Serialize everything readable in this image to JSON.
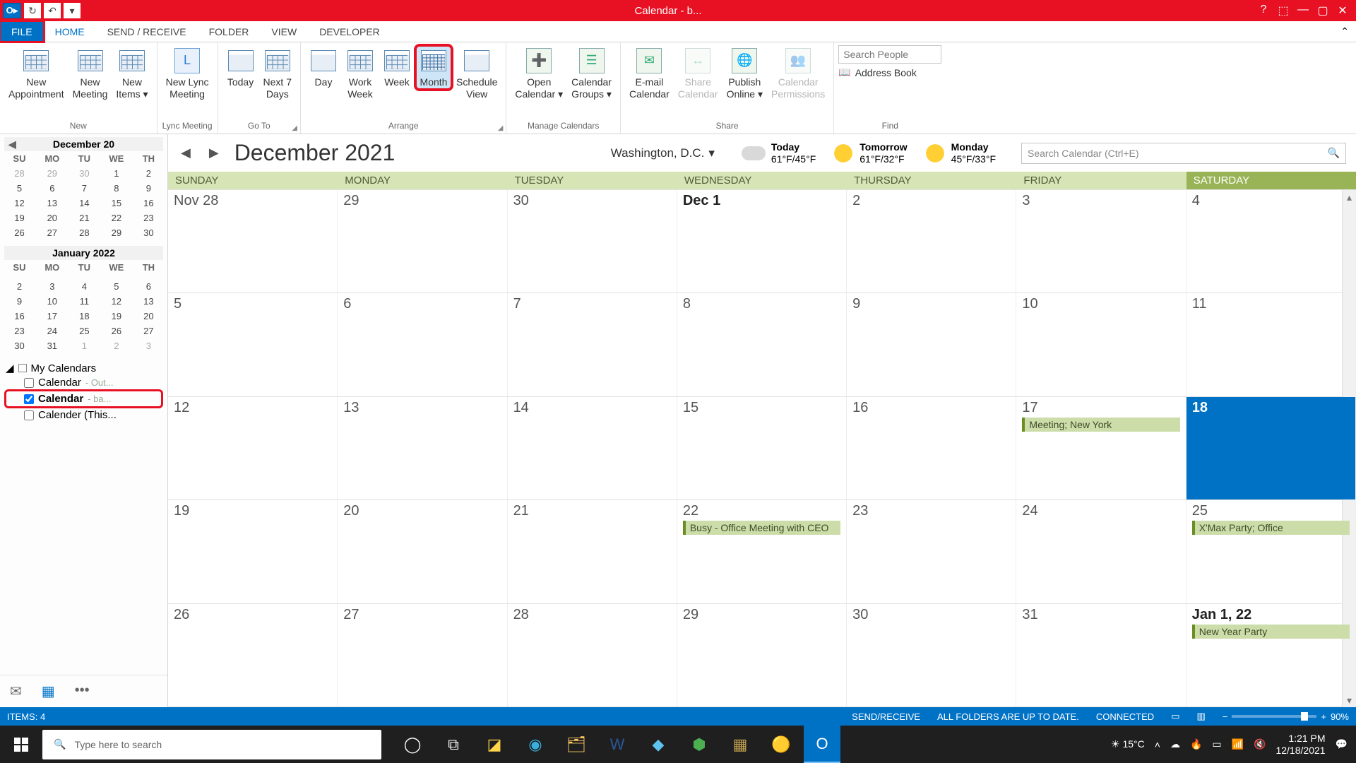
{
  "title": "Calendar - b...",
  "qat": {
    "send_receive_icon": "↻",
    "undo_icon": "↶",
    "dropdown_icon": "▾"
  },
  "tabs": {
    "file": "FILE",
    "home": "HOME",
    "send_receive": "SEND / RECEIVE",
    "folder": "FOLDER",
    "view": "VIEW",
    "developer": "DEVELOPER"
  },
  "ribbon": {
    "new_group": "New",
    "new_appointment": "New\nAppointment",
    "new_meeting": "New\nMeeting",
    "new_items": "New\nItems ▾",
    "lync_group": "Lync Meeting",
    "new_lync": "New Lync\nMeeting",
    "goto_group": "Go To",
    "today": "Today",
    "next7": "Next 7\nDays",
    "arrange_group": "Arrange",
    "day": "Day",
    "work_week": "Work\nWeek",
    "week": "Week",
    "month": "Month",
    "schedule": "Schedule\nView",
    "manage_group": "Manage Calendars",
    "open_cal": "Open\nCalendar ▾",
    "cal_groups": "Calendar\nGroups ▾",
    "share_group": "Share",
    "email_cal": "E-mail\nCalendar",
    "share_cal": "Share\nCalendar",
    "publish": "Publish\nOnline ▾",
    "cal_perms": "Calendar\nPermissions",
    "find_group": "Find",
    "search_people": "Search People",
    "address_book": "Address Book"
  },
  "cal_header": {
    "title": "December 2021",
    "location": "Washington,  D.C.",
    "weather": [
      {
        "day": "Today",
        "temp": "61°F/45°F",
        "icon": "cloud"
      },
      {
        "day": "Tomorrow",
        "temp": "61°F/32°F",
        "icon": "sun"
      },
      {
        "day": "Monday",
        "temp": "45°F/33°F",
        "icon": "sun"
      }
    ],
    "search_placeholder": "Search Calendar (Ctrl+E)"
  },
  "dow": [
    "SUNDAY",
    "MONDAY",
    "TUESDAY",
    "WEDNESDAY",
    "THURSDAY",
    "FRIDAY",
    "SATURDAY"
  ],
  "weeks": [
    [
      {
        "n": "Nov 28"
      },
      {
        "n": "29"
      },
      {
        "n": "30"
      },
      {
        "n": "Dec 1",
        "bold": true
      },
      {
        "n": "2"
      },
      {
        "n": "3"
      },
      {
        "n": "4"
      }
    ],
    [
      {
        "n": "5"
      },
      {
        "n": "6"
      },
      {
        "n": "7"
      },
      {
        "n": "8"
      },
      {
        "n": "9"
      },
      {
        "n": "10"
      },
      {
        "n": "11"
      }
    ],
    [
      {
        "n": "12"
      },
      {
        "n": "13"
      },
      {
        "n": "14"
      },
      {
        "n": "15"
      },
      {
        "n": "16"
      },
      {
        "n": "17",
        "events": [
          "Meeting; New York"
        ]
      },
      {
        "n": "18",
        "today": true
      }
    ],
    [
      {
        "n": "19"
      },
      {
        "n": "20"
      },
      {
        "n": "21"
      },
      {
        "n": "22",
        "events": [
          "Busy - Office Meeting with CEO"
        ]
      },
      {
        "n": "23"
      },
      {
        "n": "24"
      },
      {
        "n": "25",
        "events": [
          "X'Max Party; Office"
        ]
      }
    ],
    [
      {
        "n": "26"
      },
      {
        "n": "27"
      },
      {
        "n": "28"
      },
      {
        "n": "29"
      },
      {
        "n": "30"
      },
      {
        "n": "31"
      },
      {
        "n": "Jan 1, 22",
        "bold": true,
        "events": [
          "New Year Party"
        ]
      }
    ]
  ],
  "mini1": {
    "title": "December 20",
    "dow": [
      "SU",
      "MO",
      "TU",
      "WE",
      "TH"
    ],
    "rows": [
      [
        "28",
        "29",
        "30",
        "1",
        "2"
      ],
      [
        "5",
        "6",
        "7",
        "8",
        "9"
      ],
      [
        "12",
        "13",
        "14",
        "15",
        "16"
      ],
      [
        "19",
        "20",
        "21",
        "22",
        "23"
      ],
      [
        "26",
        "27",
        "28",
        "29",
        "30"
      ]
    ],
    "dim_first": 3
  },
  "mini2": {
    "title": "January 2022",
    "dow": [
      "SU",
      "MO",
      "TU",
      "WE",
      "TH"
    ],
    "rows": [
      [
        "",
        "",
        "",
        "",
        ""
      ],
      [
        "2",
        "3",
        "4",
        "5",
        "6"
      ],
      [
        "9",
        "10",
        "11",
        "12",
        "13"
      ],
      [
        "16",
        "17",
        "18",
        "19",
        "20"
      ],
      [
        "23",
        "24",
        "25",
        "26",
        "27"
      ],
      [
        "30",
        "31",
        "1",
        "2",
        "3"
      ]
    ],
    "dim_last": 3
  },
  "mycals": {
    "heading": "My Calendars",
    "items": [
      {
        "name": "Calendar",
        "suffix": " - Out...",
        "checked": false
      },
      {
        "name": "Calendar",
        "suffix": " - ba...",
        "checked": true,
        "hl": true
      },
      {
        "name": "Calender (This...",
        "suffix": "",
        "checked": false
      }
    ]
  },
  "statusbar": {
    "items": "ITEMS: 4",
    "sendreceive": "SEND/RECEIVE",
    "folders": "ALL FOLDERS ARE UP TO DATE.",
    "connected": "CONNECTED",
    "zoom": "90%"
  },
  "taskbar": {
    "search_placeholder": "Type here to search",
    "temp": "15°C",
    "time": "1:21 PM",
    "date": "12/18/2021"
  }
}
